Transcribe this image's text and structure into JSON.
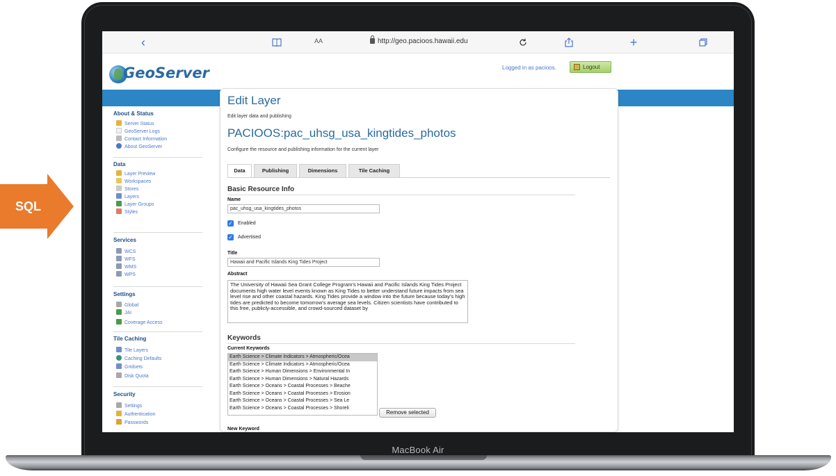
{
  "laptop": {
    "brand": "MacBook Air"
  },
  "browser": {
    "text_size_label": "AA",
    "url": "http://geo.pacioos.hawaii.edu",
    "icons": [
      "back-icon",
      "book-icon",
      "lock-icon",
      "reload-icon",
      "share-icon",
      "new-tab-icon",
      "tabs-icon"
    ]
  },
  "header": {
    "app_name": "GeoServer",
    "logged_in_text": "Logged in as pacioos.",
    "logout_label": "Logout"
  },
  "sidebar": {
    "sections": [
      {
        "title": "About & Status",
        "items": [
          "Server Status",
          "GeoServer Logs",
          "Contact Information",
          "About GeoServer"
        ]
      },
      {
        "title": "Data",
        "items": [
          "Layer Preview",
          "Workspaces",
          "Stores",
          "Layers",
          "Layer Groups",
          "Styles"
        ]
      },
      {
        "title": "Services",
        "items": [
          "WCS",
          "WFS",
          "WMS",
          "WPS"
        ]
      },
      {
        "title": "Settings",
        "items": [
          "Global",
          "JAI",
          "Coverage Access"
        ]
      },
      {
        "title": "Tile Caching",
        "items": [
          "Tile Layers",
          "Caching Defaults",
          "Gridsets",
          "Disk Quota"
        ]
      },
      {
        "title": "Security",
        "items": [
          "Settings",
          "Authentication",
          "Passwords"
        ]
      }
    ]
  },
  "main": {
    "page_title": "Edit Layer",
    "page_subtitle": "Edit layer data and publishing",
    "layer_name": "PACIOOS:pac_uhsg_usa_kingtides_photos",
    "layer_description": "Configure the resource and publishing information for the current layer",
    "tabs": [
      "Data",
      "Publishing",
      "Dimensions",
      "Tile Caching"
    ],
    "basic_info": {
      "heading": "Basic Resource Info",
      "name_label": "Name",
      "name_value": "pac_uhsg_usa_kingtides_photos",
      "enabled_label": "Enabled",
      "advertised_label": "Advertised",
      "title_label": "Title",
      "title_value": "Hawaii and Pacific Islands King Tides Project",
      "abstract_label": "Abstract",
      "abstract_value": "The University of Hawaii Sea Grant College Program's Hawaii and Pacific Islands King Tides Project documents high water level events known as King Tides to better understand future impacts from sea level rise and other coastal hazards. King Tides provide a window into the future because today's high tides are predicted to become tomorrow's average sea levels. Citizen scientists have contributed to this free, publicly-accessible, and crowd-sourced dataset by"
    },
    "keywords": {
      "heading": "Keywords",
      "current_label": "Current Keywords",
      "items": [
        "Earth Science > Climate Indicators > Atmospheric/Ocea",
        "Earth Science > Climate Indicators > Atmospheric/Ocea",
        "Earth Science > Human Dimensions > Environmental In",
        "Earth Science > Human Dimensions > Natural Hazards",
        "Earth Science > Oceans > Coastal Processes > Beache",
        "Earth Science > Oceans > Coastal Processes > Erosion",
        "Earth Science > Oceans > Coastal Processes > Sea Le",
        "Earth Science > Oceans > Coastal Processes > Shoreli"
      ],
      "remove_button": "Remove selected",
      "new_keyword_label": "New Keyword"
    }
  },
  "annotation": {
    "label": "SQL",
    "color": "#ea7a2c"
  },
  "colors": {
    "accent_blue": "#2c85c5",
    "link_blue": "#4a78c9",
    "title_blue": "#2b6aa0",
    "logout_green": "#a6cf6c"
  }
}
